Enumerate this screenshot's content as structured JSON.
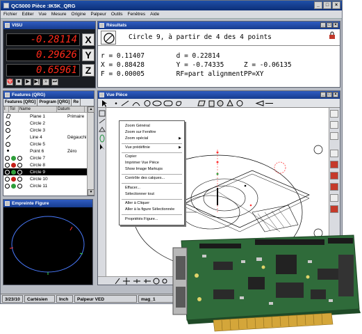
{
  "app": {
    "title": "QC5000 Pièce :IK5K_QRG",
    "menu": [
      "Fichier",
      "Editer",
      "Vue",
      "Mesure",
      "Origine",
      "Palpeur",
      "Outils",
      "Fenêtres",
      "Aide"
    ]
  },
  "visu": {
    "title": "VISU",
    "readouts": [
      {
        "value": "-0.28114",
        "axis": "X"
      },
      {
        "value": "0.29626",
        "axis": "Y"
      },
      {
        "value": "0.65961",
        "axis": "Z"
      }
    ]
  },
  "results": {
    "title": "Résultats",
    "feature_title": "Circle 9, à partir de 4 des 4 points",
    "line1": "r = 0.11407        d = 0.22814",
    "line2": "X = 0.88428        Y = -0.74335     Z = -0.06135",
    "line3": "F = 0.00005        RF=part alignmentPP=XY"
  },
  "features": {
    "title": "Features (QRG)",
    "tabs": [
      "Features [QRG]",
      "Program [QRG]",
      "Re"
    ],
    "headers": [
      "I",
      "Tol",
      "Name",
      "Datum"
    ],
    "rows": [
      {
        "name": "Plane 1",
        "datum": "Primaire"
      },
      {
        "name": "Circle 2",
        "datum": ""
      },
      {
        "name": "Circle 3",
        "datum": ""
      },
      {
        "name": "Line 4",
        "datum": "Dégauchi"
      },
      {
        "name": "Circle 5",
        "datum": ""
      },
      {
        "name": "Point 6",
        "datum": "Zéro"
      },
      {
        "name": "Circle 7",
        "datum": ""
      },
      {
        "name": "Circle 8",
        "datum": ""
      },
      {
        "name": "Circle 9",
        "datum": ""
      },
      {
        "name": "Circle 10",
        "datum": ""
      },
      {
        "name": "Circle 11",
        "datum": ""
      }
    ]
  },
  "empreinte": {
    "title": "Empreinte Figure"
  },
  "vue_piece": {
    "title": "Vue Pièce"
  },
  "context_menu": {
    "items": [
      "Zoom Général",
      "Zoom sur Fenêtre",
      "Zoom spécial",
      "Vue prédéfinie",
      "Copier",
      "Imprimer Vue Pièce",
      "Show Image Markups",
      "Contrôle des calques...",
      "Effacer...",
      "Sélectionner tout",
      "Aller à Cliquer",
      "Aller à la figure Sélectionnée",
      "Propriétés Figure..."
    ]
  },
  "status": {
    "date": "3/23/10",
    "coords": "Cartésien",
    "units": "Inch",
    "probe": "Palpeur VED",
    "mag": "mag_1"
  },
  "colors": {
    "title_blue": "#173c8e",
    "dro_red": "#ff2a1a",
    "pcb_green": "#2f6b3a"
  }
}
